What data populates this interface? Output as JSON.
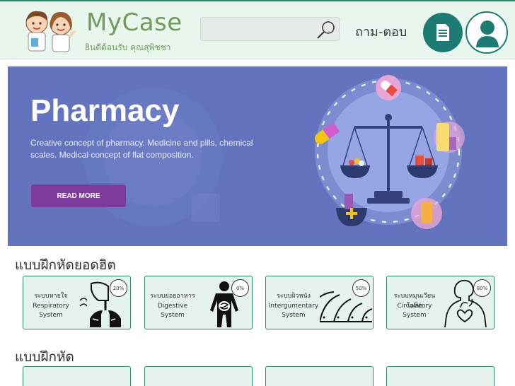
{
  "header": {
    "brand_title": "MyCase",
    "brand_subtitle": "ยินดีต้อนรับ คุณสุพิชชา",
    "search_placeholder": "",
    "qa_label": "ถาม-ตอบ"
  },
  "banner": {
    "title": "Pharmacy",
    "description": "Creative concept of pharmacy. Medicine and pills, chemical scales. Medical concept of flat composition.",
    "read_more": "READ MORE"
  },
  "popular": {
    "title": "แบบฝึกหัดยอดฮิต",
    "cards": [
      {
        "thai": "ระบบหายใจ",
        "english": "Respiratory System",
        "percent": "20%",
        "icon": "lungs-icon"
      },
      {
        "thai": "ระบบย่อยอาหาร",
        "english": "Digestive System",
        "percent": "0%",
        "icon": "digestive-icon"
      },
      {
        "thai": "ระบบผิวหนัง",
        "english": "Intergumentary System",
        "percent": "50%",
        "icon": "skin-icon"
      },
      {
        "thai": "ระบบหมุนเวียนโลหิต",
        "english": "Circulatory System",
        "percent": "80%",
        "icon": "heart-icon"
      }
    ]
  },
  "exercises": {
    "title": "แบบฝึกหัด"
  },
  "colors": {
    "brand_green": "#6e9c5b",
    "teal": "#1c7c73",
    "banner_bg": "#6373be",
    "card_bg": "#e5f3ec"
  }
}
